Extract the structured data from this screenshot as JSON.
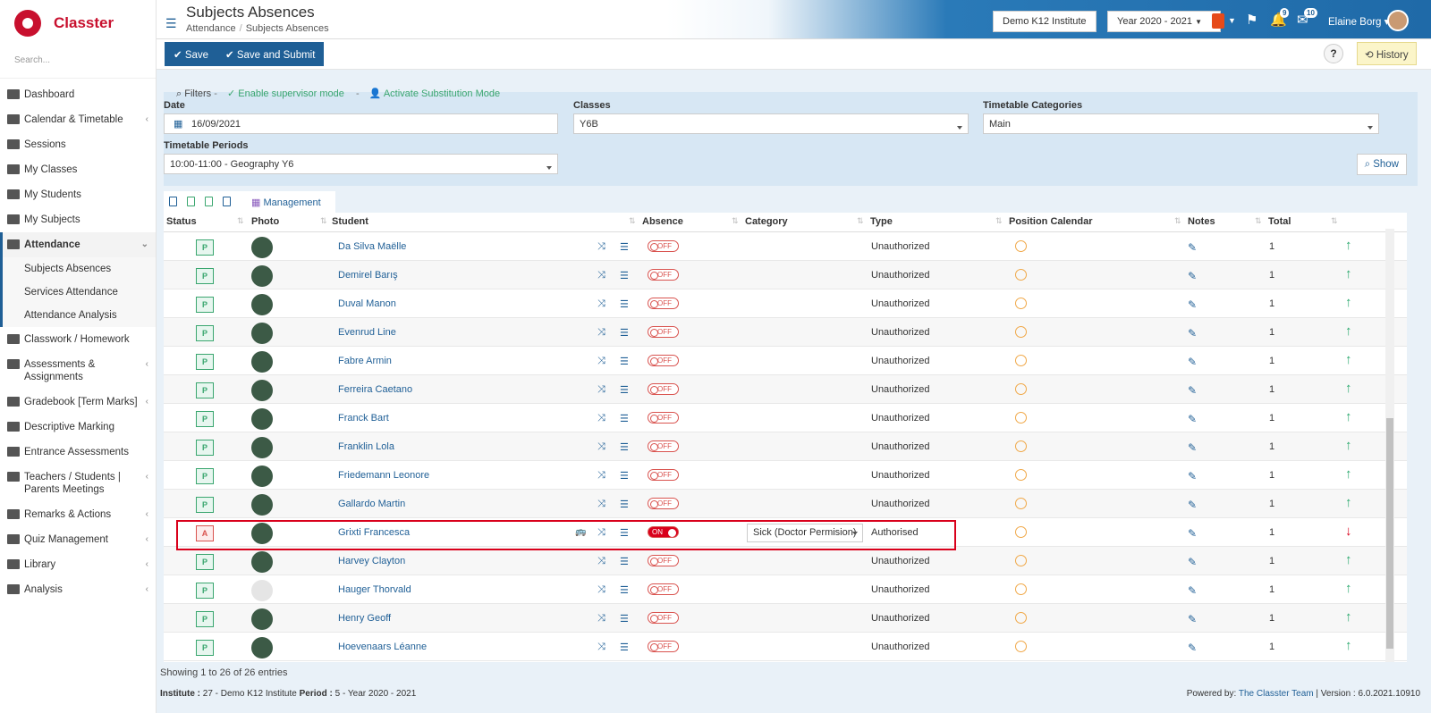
{
  "brand": {
    "name": "Classter"
  },
  "sidebar": {
    "search_placeholder": "Search...",
    "items": [
      {
        "label": "Dashboard"
      },
      {
        "label": "Calendar & Timetable"
      },
      {
        "label": "Sessions"
      },
      {
        "label": "My Classes"
      },
      {
        "label": "My Students"
      },
      {
        "label": "My Subjects"
      },
      {
        "label": "Attendance"
      }
    ],
    "attendance_sub": [
      {
        "label": "Subjects Absences"
      },
      {
        "label": "Services Attendance"
      },
      {
        "label": "Attendance Analysis"
      }
    ],
    "items_after": [
      {
        "label": "Classwork / Homework"
      },
      {
        "label": "Assessments & Assignments"
      },
      {
        "label": "Gradebook [Term Marks]"
      },
      {
        "label": "Descriptive Marking"
      },
      {
        "label": "Entrance Assessments"
      },
      {
        "label": "Teachers / Students | Parents Meetings"
      },
      {
        "label": "Remarks & Actions"
      },
      {
        "label": "Quiz Management"
      },
      {
        "label": "Library"
      },
      {
        "label": "Analysis"
      }
    ]
  },
  "header": {
    "title": "Subjects Absences",
    "breadcrumb": [
      "Attendance",
      "Subjects Absences"
    ],
    "institute": "Demo K12 Institute",
    "year": "Year 2020 - 2021",
    "notifications_count": "9",
    "messages_count": "10",
    "user_name": "Elaine Borg"
  },
  "toolbar": {
    "save_label": "Save",
    "save_submit_label": "Save and Submit",
    "help_label": "?",
    "history_label": "History"
  },
  "filters": {
    "title": "Filters",
    "supervisor_link": "Enable supervisor mode",
    "substitution_link": "Activate Substitution Mode",
    "date_label": "Date",
    "date_value": "16/09/2021",
    "classes_label": "Classes",
    "classes_value": "Y6B",
    "categories_label": "Timetable Categories",
    "categories_value": "Main",
    "periods_label": "Timetable Periods",
    "periods_value": "10:00-11:00 - Geography Y6",
    "show_label": "Show"
  },
  "table_tools": {
    "management_label": "Management"
  },
  "table": {
    "columns": [
      "Status",
      "Photo",
      "Student",
      "Absence",
      "Category",
      "Type",
      "Position Calendar",
      "Notes",
      "Total"
    ],
    "rows": [
      {
        "status": "P",
        "name": "Da Silva Maëlle",
        "absence": "OFF",
        "category": "",
        "type": "Unauthorized",
        "total": "1",
        "trend": "up"
      },
      {
        "status": "P",
        "name": "Demirel Barış",
        "absence": "OFF",
        "category": "",
        "type": "Unauthorized",
        "total": "1",
        "trend": "up"
      },
      {
        "status": "P",
        "name": "Duval Manon",
        "absence": "OFF",
        "category": "",
        "type": "Unauthorized",
        "total": "1",
        "trend": "up"
      },
      {
        "status": "P",
        "name": "Evenrud Line",
        "absence": "OFF",
        "category": "",
        "type": "Unauthorized",
        "total": "1",
        "trend": "up"
      },
      {
        "status": "P",
        "name": "Fabre Armin",
        "absence": "OFF",
        "category": "",
        "type": "Unauthorized",
        "total": "1",
        "trend": "up"
      },
      {
        "status": "P",
        "name": "Ferreira Caetano",
        "absence": "OFF",
        "category": "",
        "type": "Unauthorized",
        "total": "1",
        "trend": "up"
      },
      {
        "status": "P",
        "name": "Franck Bart",
        "absence": "OFF",
        "category": "",
        "type": "Unauthorized",
        "total": "1",
        "trend": "up"
      },
      {
        "status": "P",
        "name": "Franklin Lola",
        "absence": "OFF",
        "category": "",
        "type": "Unauthorized",
        "total": "1",
        "trend": "up"
      },
      {
        "status": "P",
        "name": "Friedemann Leonore",
        "absence": "OFF",
        "category": "",
        "type": "Unauthorized",
        "total": "1",
        "trend": "up"
      },
      {
        "status": "P",
        "name": "Gallardo Martin",
        "absence": "OFF",
        "category": "",
        "type": "Unauthorized",
        "total": "1",
        "trend": "up"
      },
      {
        "status": "A",
        "name": "Grixti Francesca",
        "absence": "ON",
        "category": "Sick (Doctor Permision)",
        "type": "Authorised",
        "total": "1",
        "trend": "down"
      },
      {
        "status": "P",
        "name": "Harvey Clayton",
        "absence": "OFF",
        "category": "",
        "type": "Unauthorized",
        "total": "1",
        "trend": "up"
      },
      {
        "status": "P",
        "name": "Hauger Thorvald",
        "absence": "OFF",
        "category": "",
        "type": "Unauthorized",
        "total": "1",
        "trend": "up"
      },
      {
        "status": "P",
        "name": "Henry Geoff",
        "absence": "OFF",
        "category": "",
        "type": "Unauthorized",
        "total": "1",
        "trend": "up"
      },
      {
        "status": "P",
        "name": "Hoevenaars Léanne",
        "absence": "OFF",
        "category": "",
        "type": "Unauthorized",
        "total": "1",
        "trend": "up"
      }
    ]
  },
  "table_info": {
    "showing": "Showing 1 to 26 of 26 entries"
  },
  "footer": {
    "institute_label": "Institute :",
    "institute_value": "27 - Demo K12 Institute",
    "period_label": "Period :",
    "period_value": "5 - Year 2020 - 2021",
    "powered_by": "Powered by:",
    "powered_link": "The Classter Team",
    "version": "| Version : 6.0.2021.10910"
  }
}
